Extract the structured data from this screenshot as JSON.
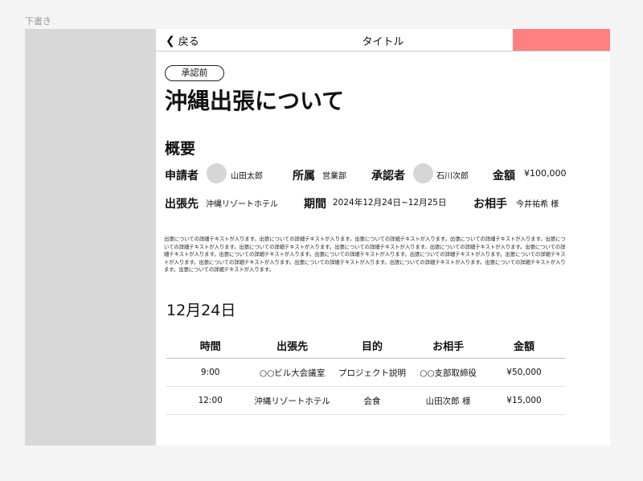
{
  "canvas_label": "下書き",
  "header": {
    "back_label": "戻る",
    "title": "タイトル"
  },
  "status_badge": "承認前",
  "page_title": "沖縄出張について",
  "overview": {
    "section_title": "概要",
    "applicant_label": "申請者",
    "applicant_name": "山田太郎",
    "department_label": "所属",
    "department_value": "営業部",
    "approver_label": "承認者",
    "approver_name": "石川次郎",
    "amount_label": "金額",
    "amount_value": "¥100,000",
    "destination_label": "出張先",
    "destination_value": "沖縄リゾートホテル",
    "period_label": "期間",
    "period_value": "2024年12月24日~12月25日",
    "partner_label": "お相手",
    "partner_value": "今井祐希 様"
  },
  "description": "出張についての詳細テキストが入ります。出張についての詳細テキストが入ります。出張についての詳細テキストが入ります。出張についての詳細テキストが入ります。出張についての詳細テキストが入ります。出張についての詳細テキストが入ります。出張についての詳細テキストが入ります。出張についての詳細テキストが入ります。出張についての詳細テキストが入ります。出張についての詳細テキストが入ります。出張についての詳細テキストが入ります。出張についての詳細テキストが入ります。出張についての詳細テキストが入ります。出張についての詳細テキストが入ります。出張についての詳細テキストが入ります。出張についての詳細テキストが入ります。出張についての詳細テキストが入ります。出張についての詳細テキストが入ります。",
  "schedule": {
    "date_title": "12月24日",
    "headers": [
      "時間",
      "出張先",
      "目的",
      "お相手",
      "金額"
    ],
    "rows": [
      [
        "9:00",
        "○○ビル大会議室",
        "プロジェクト説明",
        "○○支部取締役",
        "¥50,000"
      ],
      [
        "12:00",
        "沖縄リゾートホテル",
        "会食",
        "山田次郎 様",
        "¥15,000"
      ]
    ]
  },
  "colors": {
    "accent_block": "#ff8080",
    "side_panel": "#d8d8d8",
    "background": "#f4f4f4"
  }
}
